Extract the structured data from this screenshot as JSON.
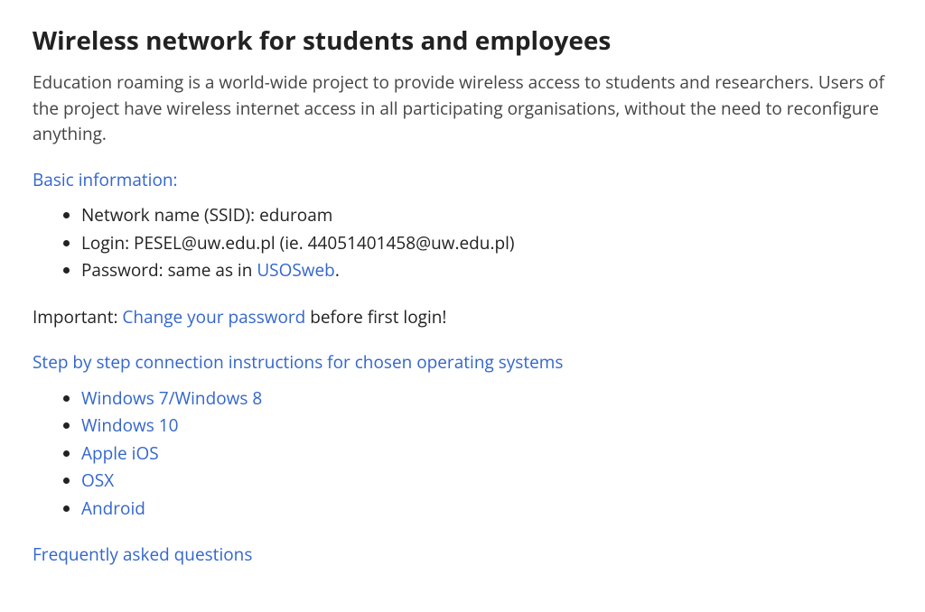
{
  "title": "Wireless network for students and employees",
  "intro": "Edu­cation roam­ing is a world-wide project to provide wireless access to students and researchers. Users of the project have wireless internet access in all participating organisations, without the need to reconfigure anything.",
  "basic": {
    "heading": "Basic information:",
    "ssid_label": "Network name (SSID): ",
    "ssid_value": "eduroam",
    "login_label": "Login: ",
    "login_value": "PESEL@uw.edu.pl (ie. 44051401458@uw.edu.pl)",
    "password_label": "Password: ",
    "password_prefix": "same as in ",
    "password_link": "USOSweb",
    "password_suffix": "."
  },
  "important": {
    "lead": "Important: ",
    "link": "Change your password",
    "tail": " before first login!"
  },
  "instructions": {
    "heading": "Step by step connection instructions for chosen operating systems",
    "items": [
      "Windows 7/Windows 8",
      "Windows 10",
      "Apple iOS",
      "OSX",
      "Android"
    ]
  },
  "faq": "Frequently asked questions"
}
